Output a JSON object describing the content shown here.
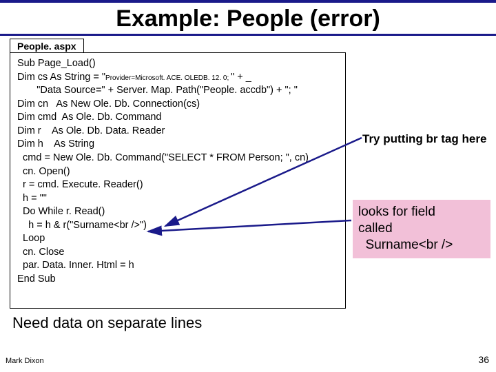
{
  "title": "Example: People (error)",
  "tab_label": "People. aspx",
  "code": {
    "l1": "Sub Page_Load()",
    "l2a": "Dim cs As String = \"",
    "l2b": "Provider=Microsoft. ACE. OLEDB. 12. 0; ",
    "l2c": "\" + _",
    "l3": "       \"Data Source=\" + Server. Map. Path(\"People. accdb\") + \"; \"",
    "l4": "Dim cn   As New Ole. Db. Connection(cs)",
    "l5": "Dim cmd  As Ole. Db. Command",
    "l6": "Dim r    As Ole. Db. Data. Reader",
    "l7": "Dim h    As String",
    "l8": "  cmd = New Ole. Db. Command(\"SELECT * FROM Person; \", cn)",
    "l9": "  cn. Open()",
    "l10": "  r = cmd. Execute. Reader()",
    "l11": "  h = \"\"",
    "l12": "  Do While r. Read()",
    "l13": "    h = h & r(\"Surname<br />\")",
    "l14": "  Loop",
    "l15": "  cn. Close",
    "l16": "  par. Data. Inner. Html = h",
    "l17": "End Sub"
  },
  "annotation1": "Try putting br tag here",
  "annotation2_line1": "looks for field",
  "annotation2_line2": "called",
  "annotation2_line3": "  Surname<br />",
  "bottom_text": "Need data on separate lines",
  "author": "Mark Dixon",
  "page_number": "36"
}
